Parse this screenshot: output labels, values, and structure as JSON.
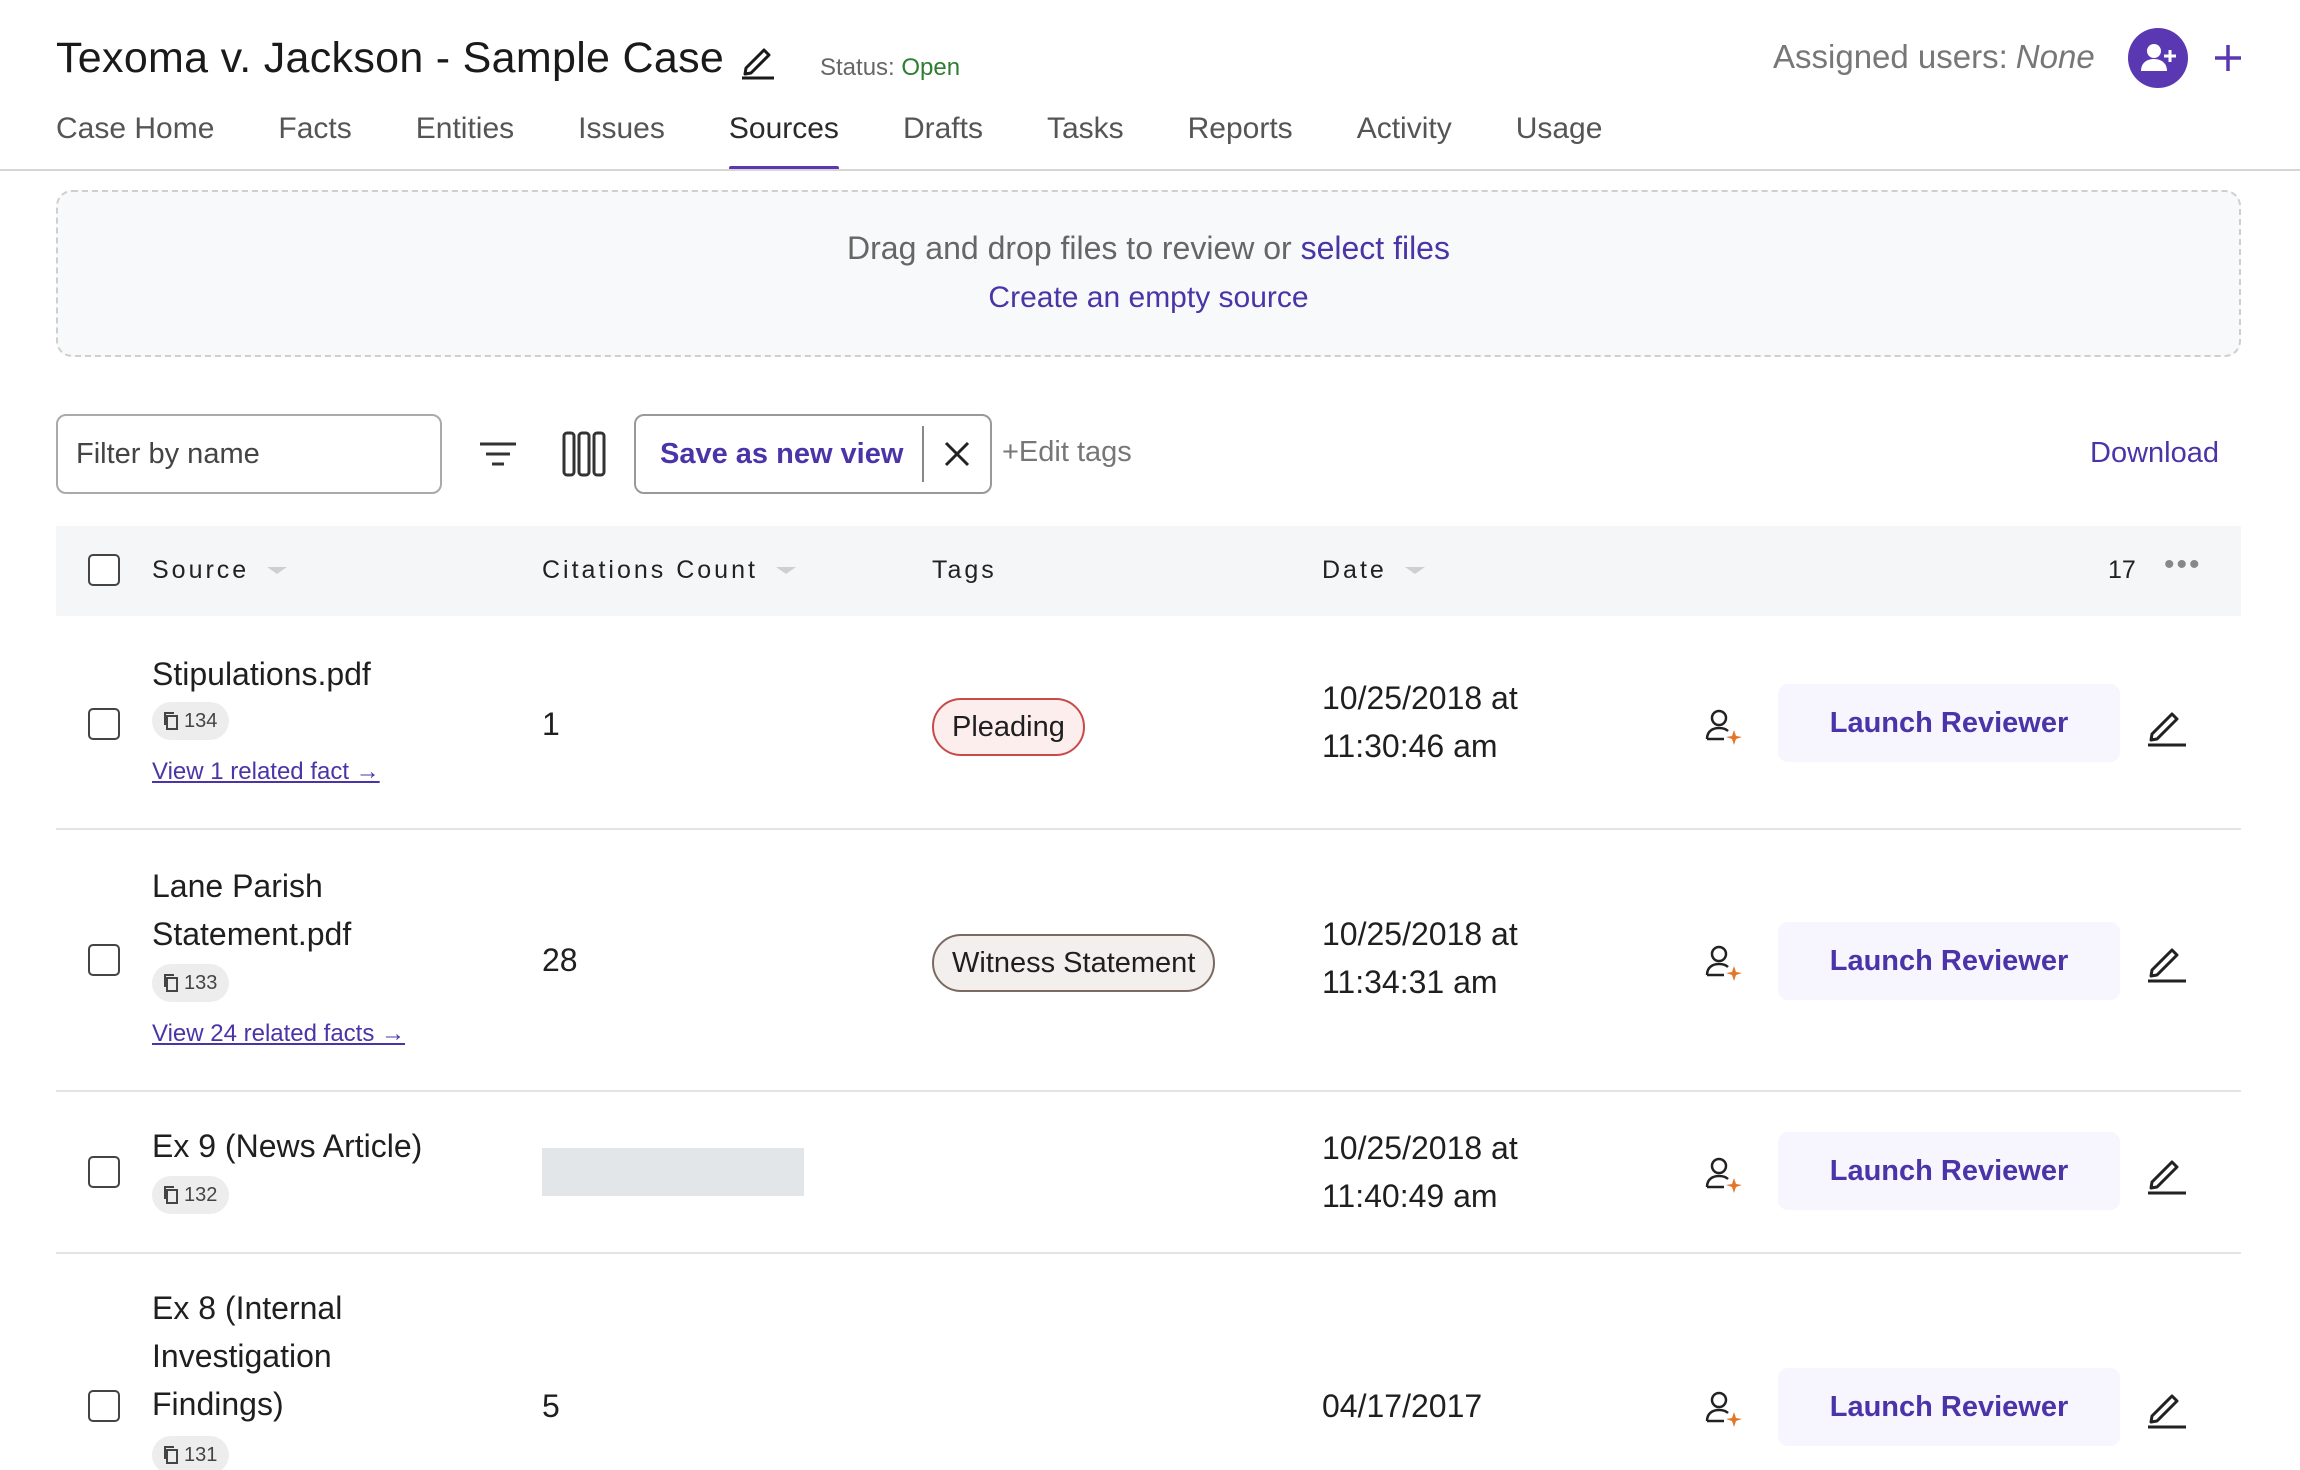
{
  "header": {
    "case_title": "Texoma v. Jackson - Sample Case",
    "status_label": "Status:",
    "status_value": "Open",
    "assigned_label": "Assigned users:",
    "assigned_value": "None"
  },
  "tabs": [
    {
      "label": "Case Home",
      "active": false
    },
    {
      "label": "Facts",
      "active": false
    },
    {
      "label": "Entities",
      "active": false
    },
    {
      "label": "Issues",
      "active": false
    },
    {
      "label": "Sources",
      "active": true
    },
    {
      "label": "Drafts",
      "active": false
    },
    {
      "label": "Tasks",
      "active": false
    },
    {
      "label": "Reports",
      "active": false
    },
    {
      "label": "Activity",
      "active": false
    },
    {
      "label": "Usage",
      "active": false
    }
  ],
  "dropzone": {
    "text": "Drag and drop files to review or",
    "select_link": "select files",
    "create_link": "Create an empty source"
  },
  "toolbar": {
    "filter_placeholder": "Filter by name",
    "save_view_label": "Save as new view",
    "edit_tags_label": "+Edit tags",
    "download_label": "Download"
  },
  "table": {
    "columns": {
      "source": "Source",
      "citations": "Citations Count",
      "tags": "Tags",
      "date": "Date"
    },
    "total_count": "17",
    "more_label": "•••",
    "launch_label": "Launch Reviewer",
    "rows": [
      {
        "name_line1": "Stipulations.pdf",
        "name_line2": "",
        "name_line3": "",
        "doc_id": "134",
        "related_link": "View 1 related fact →",
        "citations": "1",
        "tag": "Pleading",
        "date_line1": "10/25/2018 at",
        "date_line2": "11:30:46 am"
      },
      {
        "name_line1": "Lane Parish",
        "name_line2": "Statement.pdf",
        "name_line3": "",
        "doc_id": "133",
        "related_link": "View 24 related facts →",
        "citations": "28",
        "tag": "Witness Statement",
        "date_line1": "10/25/2018 at",
        "date_line2": "11:34:31 am"
      },
      {
        "name_line1": "Ex 9 (News Article)",
        "name_line2": "",
        "name_line3": "",
        "doc_id": "132",
        "related_link": "",
        "citations": "",
        "tag": "",
        "date_line1": "10/25/2018 at",
        "date_line2": "11:40:49 am"
      },
      {
        "name_line1": "Ex 8 (Internal",
        "name_line2": "Investigation",
        "name_line3": "Findings)",
        "doc_id": "131",
        "related_link": "",
        "citations": "5",
        "tag": "",
        "date_line1": "04/17/2017",
        "date_line2": ""
      }
    ]
  },
  "colors": {
    "accent": "#5a38b2",
    "link": "#4a34a8",
    "status_open": "#2e7d32",
    "pleading_border": "#c94a4a",
    "witness_border": "#7a6a62"
  }
}
